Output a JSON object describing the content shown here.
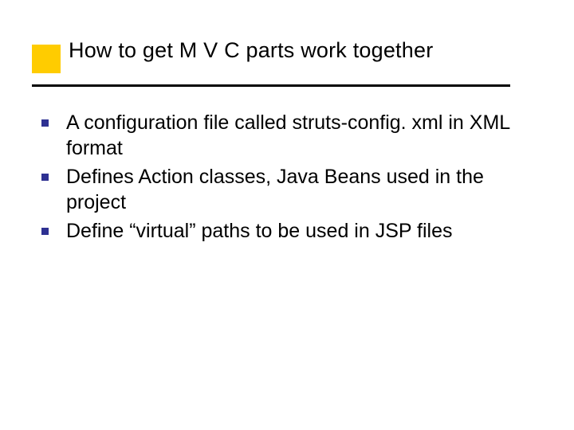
{
  "title": "How to get M V C parts work together",
  "bullets": [
    "A configuration file called struts-config. xml in XML format",
    "Defines Action classes, Java Beans used in the project",
    "Define “virtual” paths to be used in JSP files"
  ]
}
